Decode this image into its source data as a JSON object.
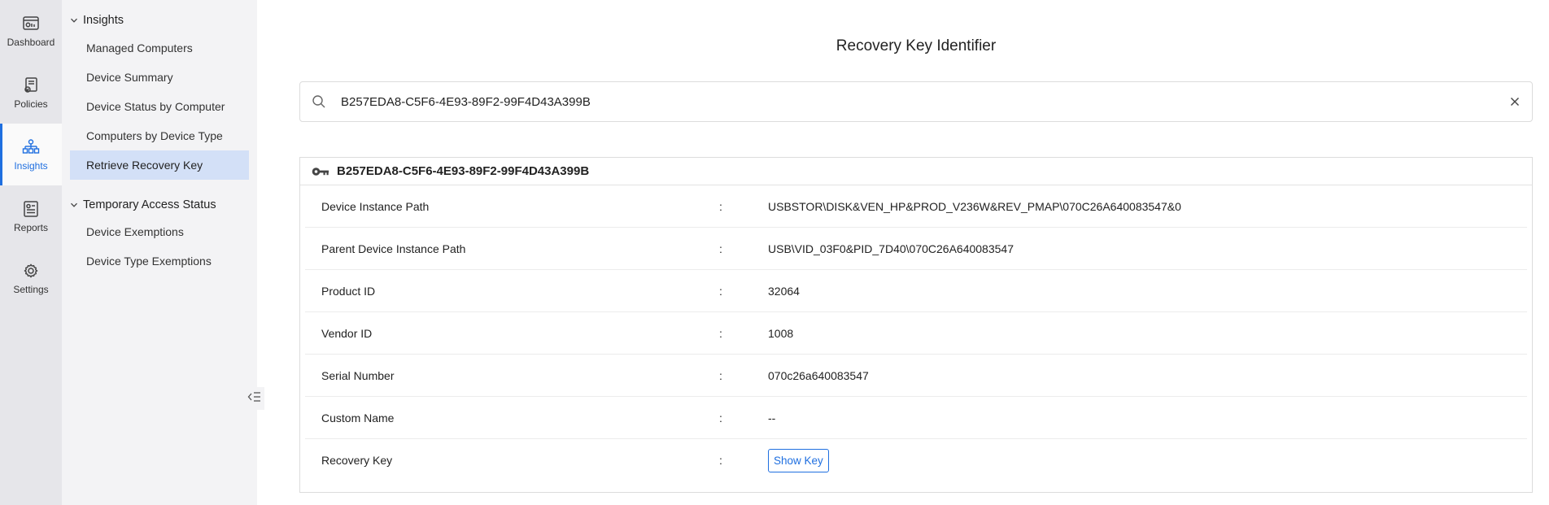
{
  "rail": {
    "items": [
      {
        "label": "Dashboard",
        "icon": "dashboard-icon"
      },
      {
        "label": "Policies",
        "icon": "policies-icon"
      },
      {
        "label": "Insights",
        "icon": "insights-icon",
        "active": true
      },
      {
        "label": "Reports",
        "icon": "reports-icon"
      },
      {
        "label": "Settings",
        "icon": "gear-icon"
      }
    ]
  },
  "menu": {
    "groups": [
      {
        "label": "Insights",
        "items": [
          "Managed Computers",
          "Device Summary",
          "Device Status by Computer",
          "Computers by Device Type",
          "Retrieve Recovery Key"
        ]
      },
      {
        "label": "Temporary Access Status",
        "items": [
          "Device Exemptions",
          "Device Type Exemptions"
        ]
      }
    ],
    "active_item": "Retrieve Recovery Key"
  },
  "main": {
    "title": "Recovery Key Identifier",
    "search": {
      "value": "B257EDA8-C5F6-4E93-89F2-99F4D43A399B",
      "placeholder": ""
    },
    "panel": {
      "id": "B257EDA8-C5F6-4E93-89F2-99F4D43A399B",
      "separator": ":",
      "rows": [
        {
          "key": "Device Instance Path",
          "value": "USBSTOR\\DISK&VEN_HP&PROD_V236W&REV_PMAP\\070C26A640083547&0"
        },
        {
          "key": "Parent Device Instance Path",
          "value": "USB\\VID_03F0&PID_7D40\\070C26A640083547"
        },
        {
          "key": "Product ID",
          "value": "32064"
        },
        {
          "key": "Vendor ID",
          "value": "1008"
        },
        {
          "key": "Serial Number",
          "value": "070c26a640083547"
        },
        {
          "key": "Custom Name",
          "value": "--"
        },
        {
          "key": "Recovery Key",
          "value": ""
        }
      ],
      "show_key_label": "Show Key"
    }
  },
  "colors": {
    "accent": "#1f6fe0",
    "rail_bg": "#e6e6ea",
    "menu_bg": "#f3f3f5",
    "active_item_bg": "#d3e0f7"
  }
}
